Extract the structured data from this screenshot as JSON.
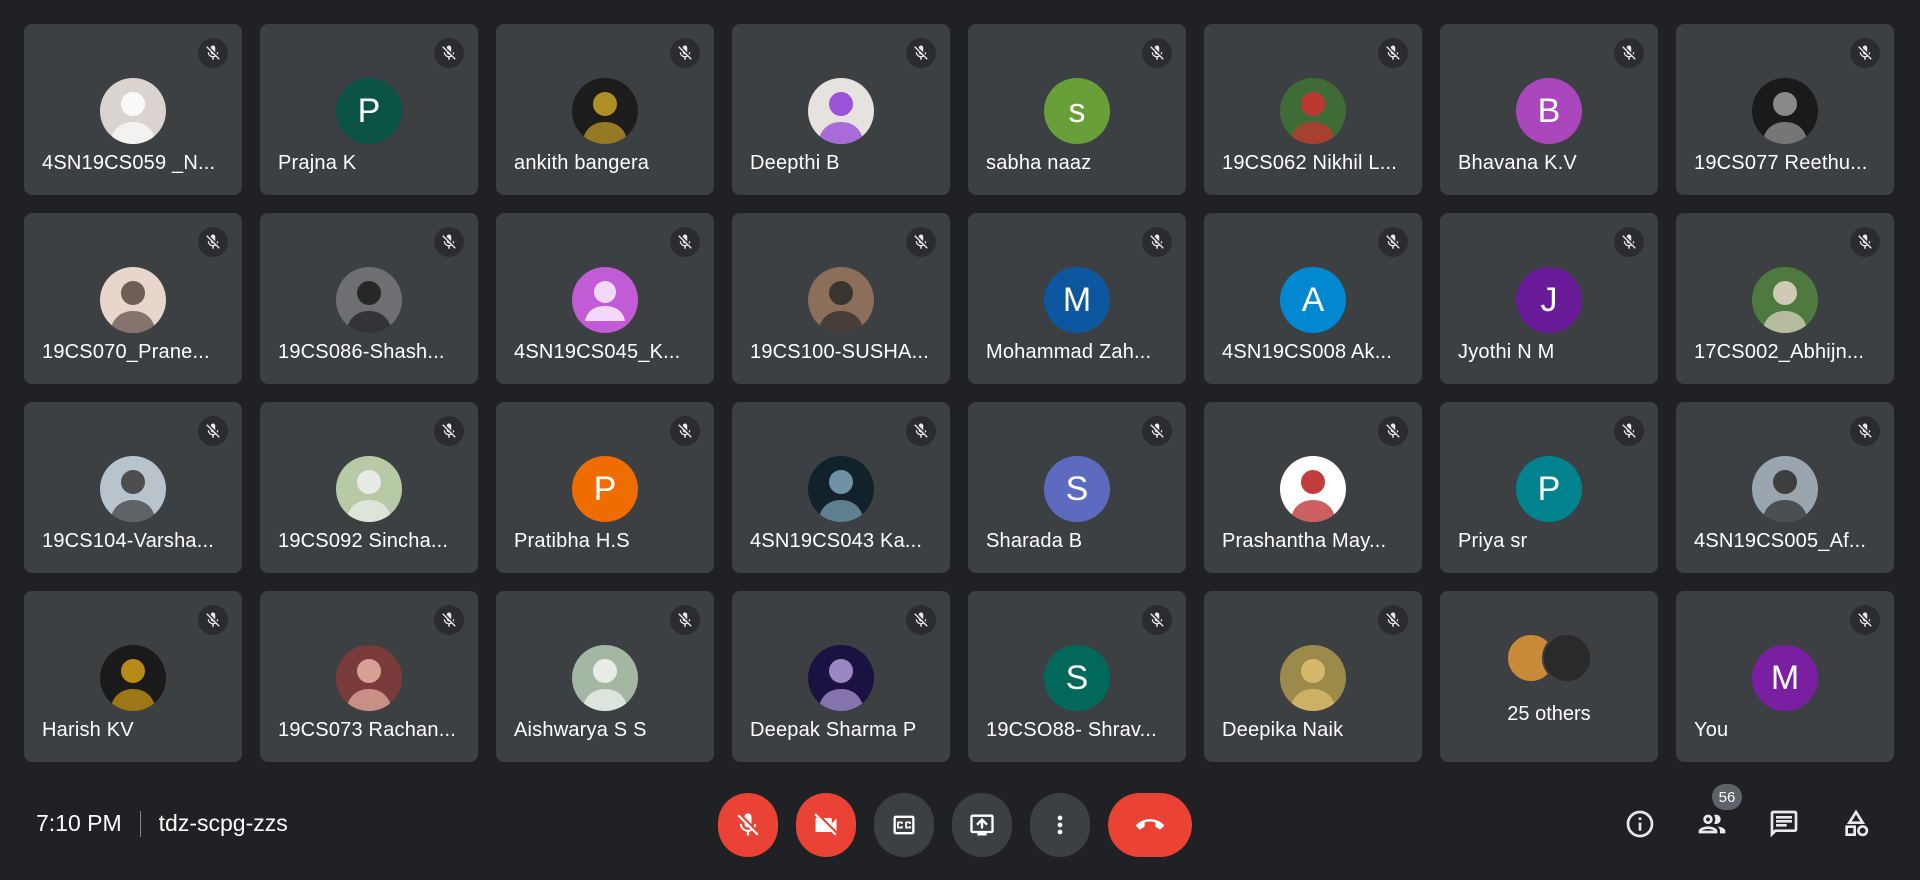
{
  "participants": [
    {
      "name": "4SN19CS059 _N...",
      "avatar": {
        "kind": "photo",
        "bg": "#d9d4cf",
        "fg": "#ffffff"
      }
    },
    {
      "name": "Prajna K",
      "avatar": {
        "kind": "letter",
        "letter": "P",
        "bg": "#0b5345"
      }
    },
    {
      "name": "ankith bangera",
      "avatar": {
        "kind": "photo",
        "bg": "#1c1c1c",
        "fg": "#c9a227"
      }
    },
    {
      "name": "Deepthi B",
      "avatar": {
        "kind": "photo",
        "bg": "#e5e2df",
        "fg": "#8e3bd6"
      }
    },
    {
      "name": "sabha naaz",
      "avatar": {
        "kind": "letter",
        "letter": "s",
        "bg": "#689f38"
      }
    },
    {
      "name": "19CS062 Nikhil L...",
      "avatar": {
        "kind": "photo",
        "bg": "#3f6b36",
        "fg": "#d32f2f"
      }
    },
    {
      "name": "Bhavana K.V",
      "avatar": {
        "kind": "letter",
        "letter": "B",
        "bg": "#ab47bc"
      }
    },
    {
      "name": "19CS077 Reethu...",
      "avatar": {
        "kind": "photo",
        "bg": "#1a1a1a",
        "fg": "#9e9e9e"
      }
    },
    {
      "name": "19CS070_Prane...",
      "avatar": {
        "kind": "photo",
        "bg": "#e8d6cc",
        "fg": "#5b4a44"
      }
    },
    {
      "name": "19CS086-Shash...",
      "avatar": {
        "kind": "photo",
        "bg": "#6d6f73",
        "fg": "#1b1b1b"
      }
    },
    {
      "name": "4SN19CS045_K...",
      "avatar": {
        "kind": "person",
        "bg": "#c25bd6",
        "fg": "#f3d9f8"
      }
    },
    {
      "name": "19CS100-SUSHA...",
      "avatar": {
        "kind": "photo",
        "bg": "#8b6f5a",
        "fg": "#2a2a2a"
      }
    },
    {
      "name": "Mohammad Zah...",
      "avatar": {
        "kind": "letter",
        "letter": "M",
        "bg": "#0d57a0"
      }
    },
    {
      "name": "4SN19CS008 Ak...",
      "avatar": {
        "kind": "letter",
        "letter": "A",
        "bg": "#0288d1"
      }
    },
    {
      "name": "Jyothi N M",
      "avatar": {
        "kind": "letter",
        "letter": "J",
        "bg": "#6a1b9a"
      }
    },
    {
      "name": "17CS002_Abhijn...",
      "avatar": {
        "kind": "photo",
        "bg": "#4e7a3f",
        "fg": "#e6d8c8"
      }
    },
    {
      "name": "19CS104-Varsha...",
      "avatar": {
        "kind": "photo",
        "bg": "#b9c3cc",
        "fg": "#3a3a3a"
      }
    },
    {
      "name": "19CS092 Sincha...",
      "avatar": {
        "kind": "photo",
        "bg": "#b8c9a6",
        "fg": "#f0f0f0"
      }
    },
    {
      "name": "Pratibha H.S",
      "avatar": {
        "kind": "letter",
        "letter": "P",
        "bg": "#ef6c00"
      }
    },
    {
      "name": "4SN19CS043 Ka...",
      "avatar": {
        "kind": "photo",
        "bg": "#12222b",
        "fg": "#7fa6b8"
      }
    },
    {
      "name": "Sharada B",
      "avatar": {
        "kind": "letter",
        "letter": "S",
        "bg": "#5c6bc0"
      }
    },
    {
      "name": "Prashantha May...",
      "avatar": {
        "kind": "photo",
        "bg": "#ffffff",
        "fg": "#b71c1c"
      }
    },
    {
      "name": "Priya sr",
      "avatar": {
        "kind": "letter",
        "letter": "P",
        "bg": "#00838f"
      }
    },
    {
      "name": "4SN19CS005_Af...",
      "avatar": {
        "kind": "photo",
        "bg": "#9aa5ad",
        "fg": "#2b2b2b"
      }
    },
    {
      "name": "Harish KV",
      "avatar": {
        "kind": "photo",
        "bg": "#1a1a1a",
        "fg": "#d4a017"
      }
    },
    {
      "name": "19CS073 Rachan...",
      "avatar": {
        "kind": "photo",
        "bg": "#7a3b3b",
        "fg": "#e8b3a6"
      }
    },
    {
      "name": "Aishwarya S S",
      "avatar": {
        "kind": "photo",
        "bg": "#a3b7a3",
        "fg": "#f5f5f5"
      }
    },
    {
      "name": "Deepak Sharma P",
      "avatar": {
        "kind": "photo",
        "bg": "#1a1240",
        "fg": "#b39ddb"
      }
    },
    {
      "name": "19CSO88- Shrav...",
      "avatar": {
        "kind": "letter",
        "letter": "S",
        "bg": "#00695c"
      }
    },
    {
      "name": "Deepika Naik",
      "avatar": {
        "kind": "photo",
        "bg": "#9c8a4a",
        "fg": "#e0c070"
      }
    }
  ],
  "others_tile": {
    "label": "25 others",
    "avatar_colors": [
      "#c98a3a",
      "#2a2a2a"
    ]
  },
  "self_tile": {
    "name": "You",
    "letter": "M",
    "bg": "#7b1fa2"
  },
  "meeting": {
    "time": "7:10 PM",
    "code": "tdz-scpg-zzs"
  },
  "controls": {
    "mic": "mic-off",
    "camera": "camera-off",
    "captions": "closed-captions",
    "present": "present-now",
    "more": "more-options",
    "hangup": "leave-call"
  },
  "right_panel": {
    "people_count": "56"
  },
  "colors": {
    "background": "#202124",
    "tile": "#3c4043",
    "red": "#ea4335"
  }
}
